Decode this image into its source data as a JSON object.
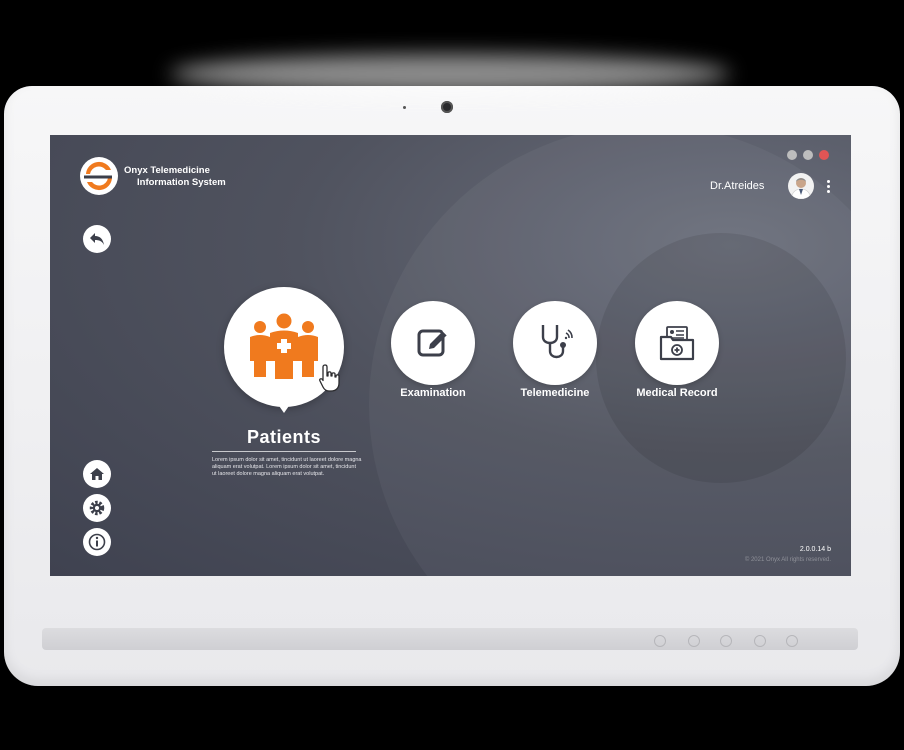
{
  "app": {
    "brand_line1": "Onyx Telemedicine",
    "brand_line2": "Information System",
    "version": "2.0.0.14 b",
    "copyright": "© 2021 Onyx All rights reserved."
  },
  "user": {
    "name": "Dr.Atreides"
  },
  "patients": {
    "title": "Patients",
    "description": "Lorem ipsum dolor sit amet, tincidunt ut laoreet dolore magna aliquam erat volutpat. Lorem ipsum dolor sit amet, tincidunt ut laoreet dolore magna aliquam erat volutpat."
  },
  "features": [
    {
      "label": "Examination",
      "icon": "edit-icon"
    },
    {
      "label": "Telemedicine",
      "icon": "stethoscope-icon"
    },
    {
      "label": "Medical Record",
      "icon": "medical-folder-icon"
    }
  ],
  "colors": {
    "accent": "#f07a1e",
    "screen_bg": "#50535f",
    "icon_dark": "#3c3f4a",
    "window_min": "#bdbdbd",
    "window_max": "#bdbdbd",
    "window_close": "#e05555"
  }
}
